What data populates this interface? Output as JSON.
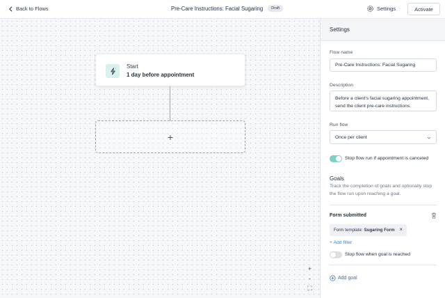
{
  "header": {
    "back_label": "Back to Flows",
    "flow_title": "Pre-Care Instructions: Facial Sugaring",
    "status_badge": "Draft",
    "settings_label": "Settings",
    "activate_label": "Activate"
  },
  "canvas": {
    "start_node": {
      "label": "Start",
      "trigger": "1 day before appointment",
      "icon": "lightning-bolt-icon"
    },
    "add_step_symbol": "+",
    "zoom": {
      "in": "+",
      "out": "-",
      "fit": "⛶"
    }
  },
  "settings_panel": {
    "title": "Settings",
    "flow_name_label": "Flow name",
    "flow_name_value": "Pre-Care Instructions: Facial Sugaring",
    "description_label": "Description",
    "description_value": "Before a client's facial sugaring appointment, send the client pre-care instructions.",
    "run_flow_label": "Run flow",
    "run_flow_value": "Once per client",
    "stop_on_cancel_label": "Stop flow run if appointment is canceled",
    "stop_on_cancel_enabled": true,
    "goals_title": "Goals",
    "goals_description": "Track the completion of goals and optionally stop the flow run upon reaching a goal.",
    "goal": {
      "name": "Form submitted",
      "filter_prefix": "Form template:",
      "filter_value": "Sugaring Form",
      "add_filter_label": "+ Add filter",
      "stop_on_goal_label": "Stop flow when goal is reached",
      "stop_on_goal_enabled": false
    },
    "add_goal_label": "Add goal"
  },
  "colors": {
    "accent_teal": "#7ecfc6",
    "link_blue": "#3b7fc4",
    "canvas_bg": "#f6f7f9"
  }
}
